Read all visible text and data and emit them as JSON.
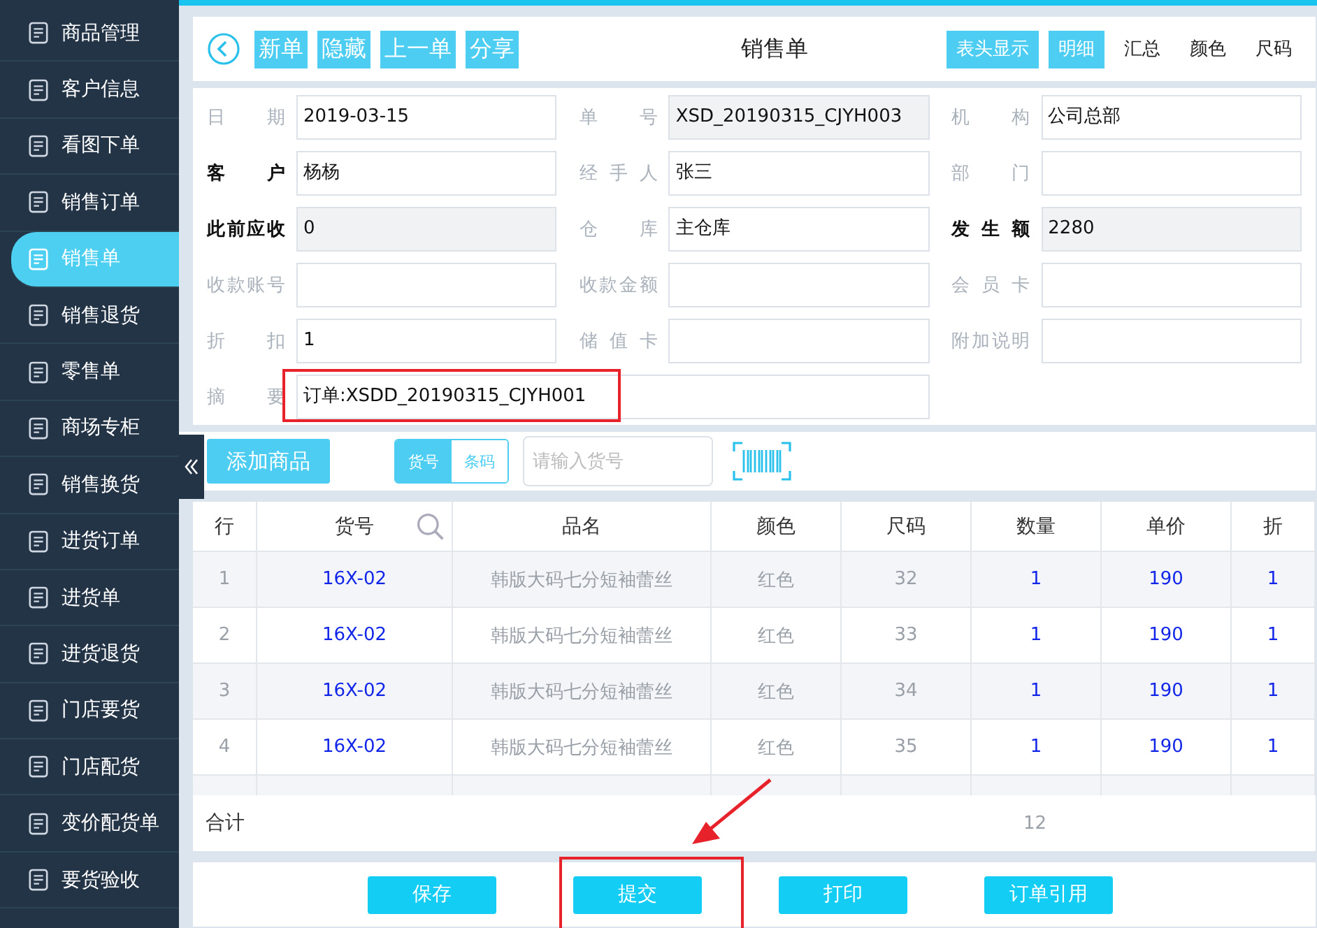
{
  "sidebar": {
    "items": [
      {
        "label": "商品管理",
        "selected": false
      },
      {
        "label": "客户信息",
        "selected": false
      },
      {
        "label": "看图下单",
        "selected": false
      },
      {
        "label": "销售订单",
        "selected": false
      },
      {
        "label": "销售单",
        "selected": true
      },
      {
        "label": "销售退货",
        "selected": false
      },
      {
        "label": "零售单",
        "selected": false
      },
      {
        "label": "商场专柜",
        "selected": false
      },
      {
        "label": "销售换货",
        "selected": false
      },
      {
        "label": "进货订单",
        "selected": false
      },
      {
        "label": "进货单",
        "selected": false
      },
      {
        "label": "进货退货",
        "selected": false
      },
      {
        "label": "门店要货",
        "selected": false
      },
      {
        "label": "门店配货",
        "selected": false
      },
      {
        "label": "变价配货单",
        "selected": false
      },
      {
        "label": "要货验收",
        "selected": false
      }
    ]
  },
  "header": {
    "actions": [
      "新单",
      "隐藏",
      "上一单",
      "分享"
    ],
    "title": "销售单",
    "header_toggle": {
      "label": "表头显示",
      "on": true
    },
    "view_tabs": [
      {
        "label": "明细",
        "selected": true
      },
      {
        "label": "汇总",
        "selected": false
      },
      {
        "label": "颜色",
        "selected": false
      },
      {
        "label": "尺码",
        "selected": false
      }
    ]
  },
  "form": {
    "fields": [
      {
        "label": "日期",
        "value": "2019-03-15",
        "bold": false,
        "readonly": false
      },
      {
        "label": "单号",
        "value": "XSD_20190315_CJYH003",
        "bold": false,
        "readonly": true
      },
      {
        "label": "机构",
        "value": "公司总部",
        "bold": false,
        "readonly": false
      },
      {
        "label": "客户",
        "value": "杨杨",
        "bold": true,
        "readonly": false
      },
      {
        "label": "经手人",
        "value": "张三",
        "bold": false,
        "readonly": false
      },
      {
        "label": "部门",
        "bold": false,
        "readonly": false
      },
      {
        "label": "此前应收",
        "value": "0",
        "bold": true,
        "readonly": true
      },
      {
        "label": "仓库",
        "value": "主仓库",
        "bold": false,
        "readonly": false
      },
      {
        "label": "发生额",
        "value": "2280",
        "bold": true,
        "readonly": true
      },
      {
        "label": "收款账号",
        "bold": false,
        "readonly": false
      },
      {
        "label": "收款金额",
        "bold": false,
        "readonly": false
      },
      {
        "label": "会员卡",
        "bold": false,
        "readonly": false
      },
      {
        "label": "折扣",
        "value": "1",
        "bold": false,
        "readonly": false
      },
      {
        "label": "储值卡",
        "bold": false,
        "readonly": false
      },
      {
        "label": "附加说明",
        "bold": false,
        "readonly": false
      },
      {
        "label": "摘要",
        "value": "订单:XSDD_20190315_CJYH001",
        "bold": false,
        "readonly": false,
        "wide": true,
        "highlighted": true
      }
    ]
  },
  "toolbar": {
    "add_button": "添加商品",
    "search_modes": [
      {
        "label": "货号",
        "selected": true
      },
      {
        "label": "条码",
        "selected": false
      }
    ],
    "search": {
      "placeholder": "请输入货号"
    }
  },
  "table": {
    "columns": [
      "行",
      "货号",
      "品名",
      "颜色",
      "尺码",
      "数量",
      "单价",
      "折"
    ],
    "rows": [
      [
        "1",
        "16X-02",
        "韩版大码七分短袖蕾丝",
        "红色",
        "32",
        "1",
        "190",
        "1"
      ],
      [
        "2",
        "16X-02",
        "韩版大码七分短袖蕾丝",
        "红色",
        "33",
        "1",
        "190",
        "1"
      ],
      [
        "3",
        "16X-02",
        "韩版大码七分短袖蕾丝",
        "红色",
        "34",
        "1",
        "190",
        "1"
      ],
      [
        "4",
        "16X-02",
        "韩版大码七分短袖蕾丝",
        "红色",
        "35",
        "1",
        "190",
        "1"
      ]
    ],
    "total": {
      "label": "合计",
      "quantity": "12"
    }
  },
  "footer": {
    "buttons": [
      {
        "label": "保存",
        "highlighted": false
      },
      {
        "label": "提交",
        "highlighted": true
      },
      {
        "label": "打印",
        "highlighted": false
      },
      {
        "label": "订单引用",
        "highlighted": false
      }
    ]
  }
}
